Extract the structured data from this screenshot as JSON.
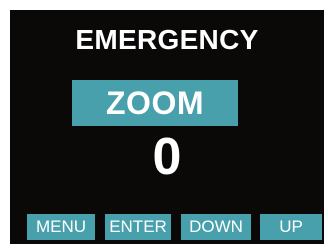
{
  "display": {
    "title": "EMERGENCY",
    "mode": "ZOOM",
    "value": "0"
  },
  "softkeys": [
    {
      "label": "MENU"
    },
    {
      "label": "ENTER"
    },
    {
      "label": "DOWN"
    },
    {
      "label": "UP"
    }
  ],
  "colors": {
    "screen_background": "#0b0908",
    "accent": "#47a0ab",
    "text": "#ffffff"
  }
}
